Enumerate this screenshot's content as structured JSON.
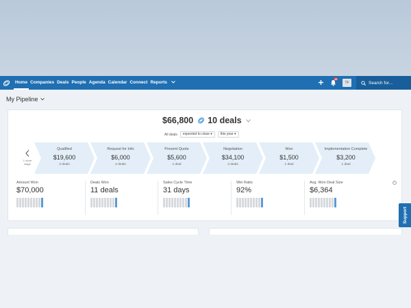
{
  "nav": {
    "items": [
      {
        "label": "Home",
        "active": true
      },
      {
        "label": "Companies"
      },
      {
        "label": "Deals"
      },
      {
        "label": "People"
      },
      {
        "label": "Agenda"
      },
      {
        "label": "Calendar"
      },
      {
        "label": "Connect"
      },
      {
        "label": "Reports"
      }
    ],
    "more_icon": "chevron-down-icon",
    "add_icon": "plus-icon",
    "notifications_icon": "bell-icon",
    "notifications_count": "16",
    "avatar_initials": "TF",
    "search_placeholder": "Search for..."
  },
  "page": {
    "title": "My Pipeline"
  },
  "pipeline": {
    "total_amount": "$66,800",
    "total_deals": "10 deals",
    "filters_label": "All deals",
    "filter_close": "expected to close",
    "filter_period": "this year",
    "prev_label": "1 more stage",
    "stages": [
      {
        "name": "Qualified",
        "amount": "$19,600",
        "deals": "3 deals"
      },
      {
        "name": "Request for Info",
        "amount": "$6,000",
        "deals": "2 deals"
      },
      {
        "name": "Present Quote",
        "amount": "$5,600",
        "deals": "1 deal"
      },
      {
        "name": "Negotiation",
        "amount": "$34,100",
        "deals": "3 deals"
      },
      {
        "name": "Won",
        "amount": "$1,500",
        "deals": "1 deal"
      },
      {
        "name": "Implementation Complete",
        "amount": "$3,200",
        "deals": "1 deal"
      }
    ]
  },
  "metrics": [
    {
      "label": "Amount Won",
      "value": "$70,000"
    },
    {
      "label": "Deals Won",
      "value": "11 deals"
    },
    {
      "label": "Sales Cycle Time",
      "value": "31 days"
    },
    {
      "label": "Win Ratio",
      "value": "92%"
    },
    {
      "label": "Avg. Won Deal Size",
      "value": "$6,364"
    }
  ],
  "help_icon": "question-icon",
  "help_glyph": "?",
  "support_label": "Support",
  "colors": {
    "brand": "#1f6fb2",
    "stage_bg": "#e4eef8",
    "bar_highlight": "#5a9ad6",
    "badge": "#e23b3b"
  }
}
